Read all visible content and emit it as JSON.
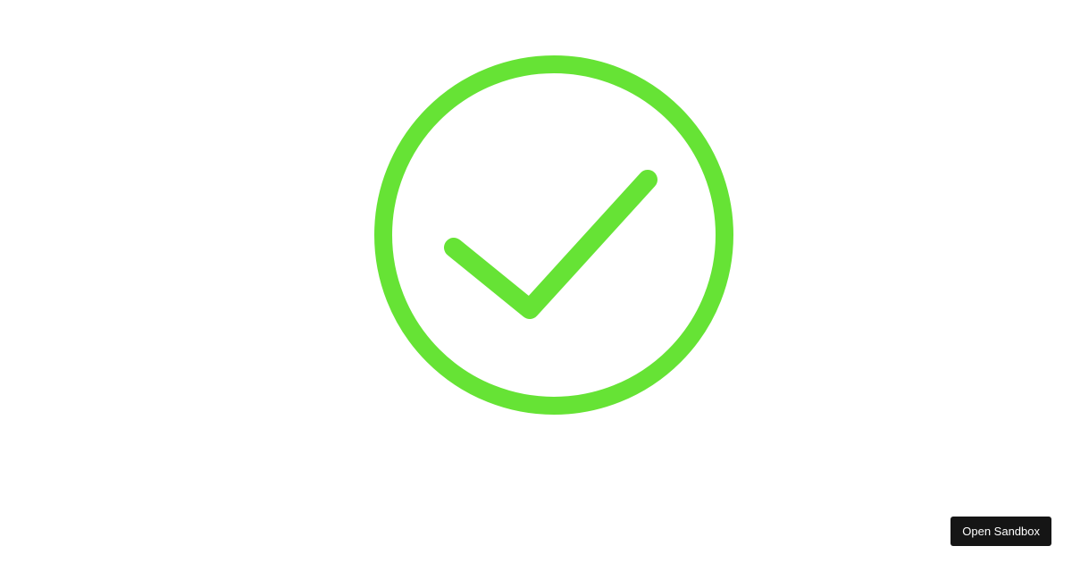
{
  "success_icon": {
    "icon": "check-circle-icon",
    "color": "#66e335"
  },
  "sandbox_button": {
    "label": "Open Sandbox",
    "background": "#151515",
    "text_color": "#ffffff"
  }
}
